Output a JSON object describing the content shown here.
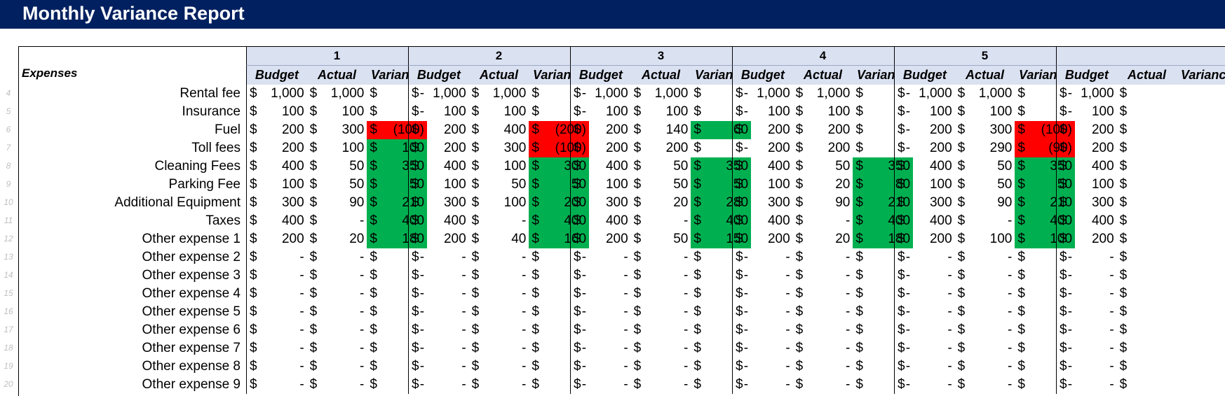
{
  "title": "Monthly Variance Report",
  "row_numbers": [
    "4",
    "5",
    "6",
    "7",
    "8",
    "9",
    "10",
    "11",
    "12",
    "13",
    "14",
    "15",
    "16",
    "17",
    "18",
    "19",
    "20"
  ],
  "expenses_header": "Expenses",
  "column_headers": [
    "Budget",
    "Actual",
    "Variance"
  ],
  "currency_symbol": "$",
  "status_colors": {
    "unfavorable": "#ff0000",
    "favorable": "#00b050",
    "header_fill": "#dae1f1",
    "banner": "#002060"
  },
  "expense_labels": [
    "Rental fee",
    "Insurance",
    "Fuel",
    "Toll fees",
    "Cleaning Fees",
    "Parking Fee",
    "Additional Equipment",
    "Taxes",
    "Other expense 1",
    "Other expense 2",
    "Other expense 3",
    "Other expense 4",
    "Other expense 5",
    "Other expense 6",
    "Other expense 7",
    "Other expense 8",
    "Other expense 9"
  ],
  "months": [
    {
      "label": "1",
      "rows": [
        [
          "1,000",
          "1,000",
          "-",
          ""
        ],
        [
          "100",
          "100",
          "-",
          ""
        ],
        [
          "200",
          "300",
          "(100)",
          "red"
        ],
        [
          "200",
          "100",
          "100",
          "green"
        ],
        [
          "400",
          "50",
          "350",
          "green"
        ],
        [
          "100",
          "50",
          "50",
          "green"
        ],
        [
          "300",
          "90",
          "210",
          "green"
        ],
        [
          "400",
          "-",
          "400",
          "green"
        ],
        [
          "200",
          "20",
          "180",
          "green"
        ],
        [
          "-",
          "-",
          "-",
          ""
        ],
        [
          "-",
          "-",
          "-",
          ""
        ],
        [
          "-",
          "-",
          "-",
          ""
        ],
        [
          "-",
          "-",
          "-",
          ""
        ],
        [
          "-",
          "-",
          "-",
          ""
        ],
        [
          "-",
          "-",
          "-",
          ""
        ],
        [
          "-",
          "-",
          "-",
          ""
        ],
        [
          "-",
          "-",
          "-",
          ""
        ]
      ]
    },
    {
      "label": "2",
      "rows": [
        [
          "1,000",
          "1,000",
          "-",
          ""
        ],
        [
          "100",
          "100",
          "-",
          ""
        ],
        [
          "200",
          "400",
          "(200)",
          "red"
        ],
        [
          "200",
          "300",
          "(100)",
          "red"
        ],
        [
          "400",
          "100",
          "300",
          "green"
        ],
        [
          "100",
          "50",
          "50",
          "green"
        ],
        [
          "300",
          "100",
          "200",
          "green"
        ],
        [
          "400",
          "-",
          "400",
          "green"
        ],
        [
          "200",
          "40",
          "160",
          "green"
        ],
        [
          "-",
          "-",
          "-",
          ""
        ],
        [
          "-",
          "-",
          "-",
          ""
        ],
        [
          "-",
          "-",
          "-",
          ""
        ],
        [
          "-",
          "-",
          "-",
          ""
        ],
        [
          "-",
          "-",
          "-",
          ""
        ],
        [
          "-",
          "-",
          "-",
          ""
        ],
        [
          "-",
          "-",
          "-",
          ""
        ],
        [
          "-",
          "-",
          "-",
          ""
        ]
      ]
    },
    {
      "label": "3",
      "rows": [
        [
          "1,000",
          "1,000",
          "-",
          ""
        ],
        [
          "100",
          "100",
          "-",
          ""
        ],
        [
          "200",
          "140",
          "60",
          "green"
        ],
        [
          "200",
          "200",
          "-",
          ""
        ],
        [
          "400",
          "50",
          "350",
          "green"
        ],
        [
          "100",
          "50",
          "50",
          "green"
        ],
        [
          "300",
          "20",
          "280",
          "green"
        ],
        [
          "400",
          "-",
          "400",
          "green"
        ],
        [
          "200",
          "50",
          "150",
          "green"
        ],
        [
          "-",
          "-",
          "-",
          ""
        ],
        [
          "-",
          "-",
          "-",
          ""
        ],
        [
          "-",
          "-",
          "-",
          ""
        ],
        [
          "-",
          "-",
          "-",
          ""
        ],
        [
          "-",
          "-",
          "-",
          ""
        ],
        [
          "-",
          "-",
          "-",
          ""
        ],
        [
          "-",
          "-",
          "-",
          ""
        ],
        [
          "-",
          "-",
          "-",
          ""
        ]
      ]
    },
    {
      "label": "4",
      "rows": [
        [
          "1,000",
          "1,000",
          "-",
          ""
        ],
        [
          "100",
          "100",
          "-",
          ""
        ],
        [
          "200",
          "200",
          "-",
          ""
        ],
        [
          "200",
          "200",
          "-",
          ""
        ],
        [
          "400",
          "50",
          "350",
          "green"
        ],
        [
          "100",
          "20",
          "80",
          "green"
        ],
        [
          "300",
          "90",
          "210",
          "green"
        ],
        [
          "400",
          "-",
          "400",
          "green"
        ],
        [
          "200",
          "20",
          "180",
          "green"
        ],
        [
          "-",
          "-",
          "-",
          ""
        ],
        [
          "-",
          "-",
          "-",
          ""
        ],
        [
          "-",
          "-",
          "-",
          ""
        ],
        [
          "-",
          "-",
          "-",
          ""
        ],
        [
          "-",
          "-",
          "-",
          ""
        ],
        [
          "-",
          "-",
          "-",
          ""
        ],
        [
          "-",
          "-",
          "-",
          ""
        ],
        [
          "-",
          "-",
          "-",
          ""
        ]
      ]
    },
    {
      "label": "5",
      "rows": [
        [
          "1,000",
          "1,000",
          "-",
          ""
        ],
        [
          "100",
          "100",
          "-",
          ""
        ],
        [
          "200",
          "300",
          "(100)",
          "red"
        ],
        [
          "200",
          "290",
          "(90)",
          "red"
        ],
        [
          "400",
          "50",
          "350",
          "green"
        ],
        [
          "100",
          "50",
          "50",
          "green"
        ],
        [
          "300",
          "90",
          "210",
          "green"
        ],
        [
          "400",
          "-",
          "400",
          "green"
        ],
        [
          "200",
          "100",
          "100",
          "green"
        ],
        [
          "-",
          "-",
          "-",
          ""
        ],
        [
          "-",
          "-",
          "-",
          ""
        ],
        [
          "-",
          "-",
          "-",
          ""
        ],
        [
          "-",
          "-",
          "-",
          ""
        ],
        [
          "-",
          "-",
          "-",
          ""
        ],
        [
          "-",
          "-",
          "-",
          ""
        ],
        [
          "-",
          "-",
          "-",
          ""
        ],
        [
          "-",
          "-",
          "-",
          ""
        ]
      ]
    },
    {
      "label": "",
      "rows": [
        [
          "1,000",
          "",
          ""
        ],
        [
          "100",
          "",
          ""
        ],
        [
          "200",
          "",
          ""
        ],
        [
          "200",
          "",
          ""
        ],
        [
          "400",
          "",
          ""
        ],
        [
          "100",
          "",
          ""
        ],
        [
          "300",
          "",
          ""
        ],
        [
          "400",
          "",
          ""
        ],
        [
          "200",
          "",
          ""
        ],
        [
          "-",
          "",
          ""
        ],
        [
          "-",
          "",
          ""
        ],
        [
          "-",
          "",
          ""
        ],
        [
          "-",
          "",
          ""
        ],
        [
          "-",
          "",
          ""
        ],
        [
          "-",
          "",
          ""
        ],
        [
          "-",
          "",
          ""
        ],
        [
          "-",
          "",
          ""
        ]
      ]
    }
  ]
}
